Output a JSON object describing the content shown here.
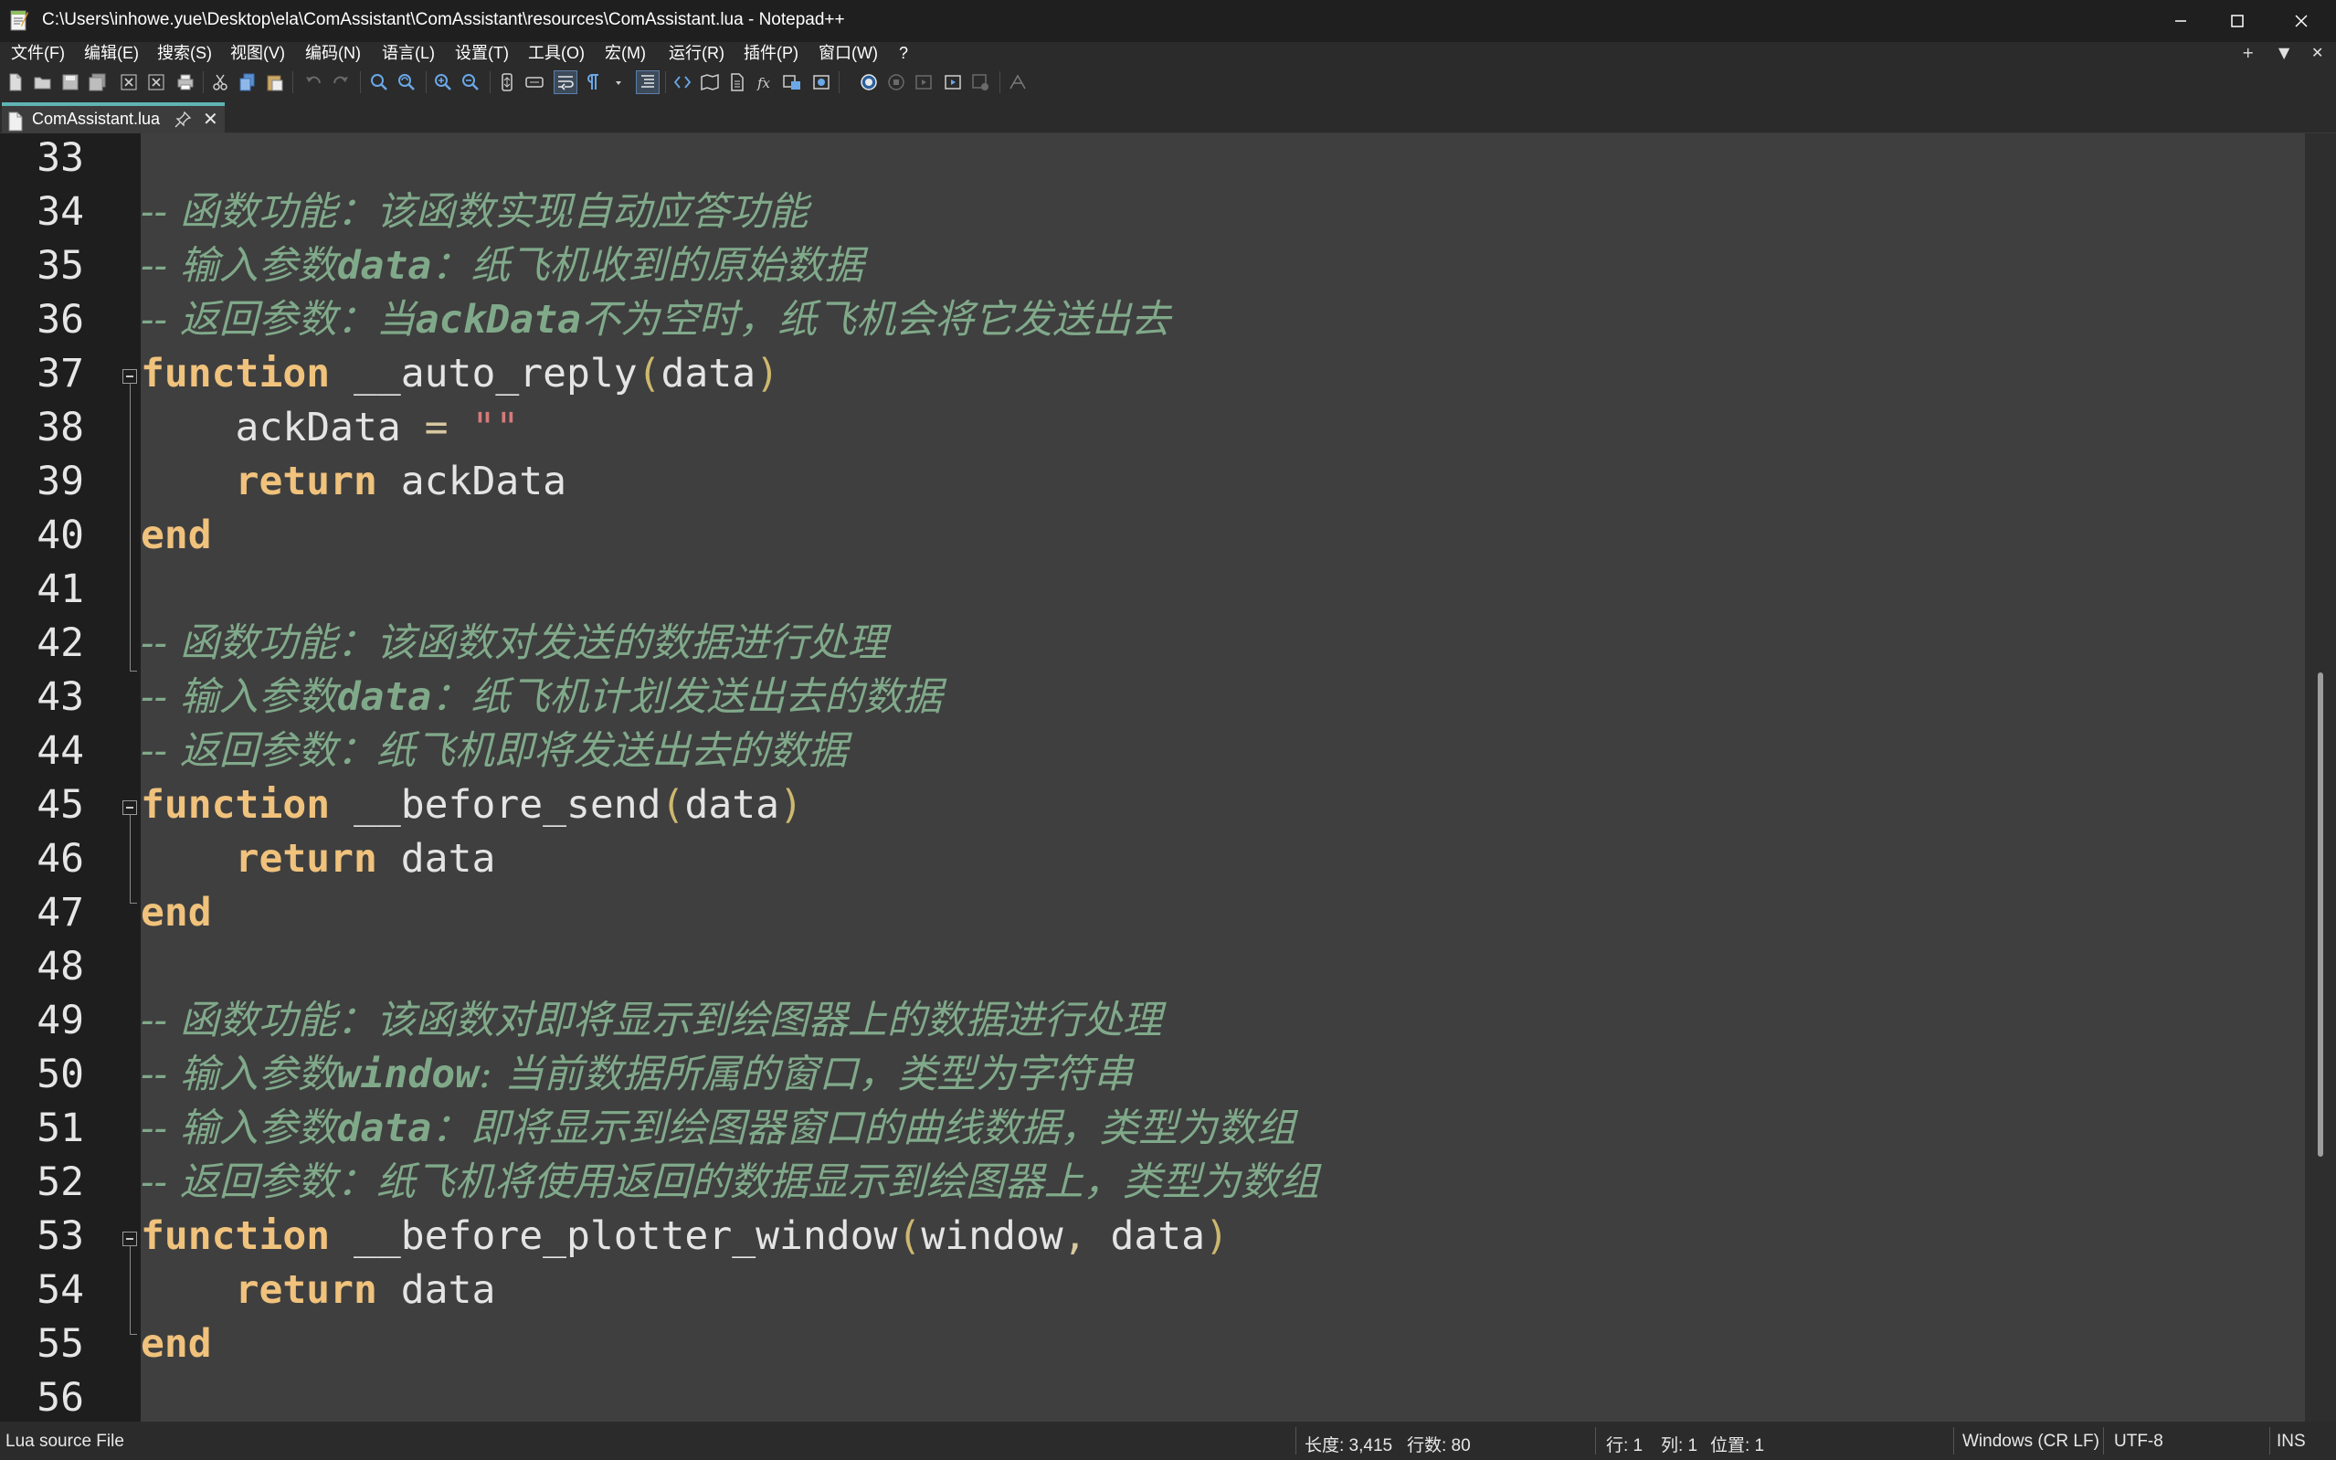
{
  "window": {
    "title": "C:\\Users\\inhowe.yue\\Desktop\\ela\\ComAssistant\\ComAssistant\\resources\\ComAssistant.lua - Notepad++"
  },
  "menu": {
    "items": [
      "文件(F)",
      "编辑(E)",
      "搜索(S)",
      "视图(V)",
      "编码(N)",
      "语言(L)",
      "设置(T)",
      "工具(O)",
      "宏(M)",
      "运行(R)",
      "插件(P)",
      "窗口(W)",
      "?"
    ],
    "right": [
      "+",
      "▼",
      "✕"
    ]
  },
  "toolbar": {
    "icons": [
      "new-file-icon",
      "open-file-icon",
      "save-icon",
      "save-all-icon",
      "close-icon",
      "close-all-icon",
      "print-icon",
      "cut-icon",
      "copy-icon",
      "paste-icon",
      "undo-icon",
      "redo-icon",
      "find-icon",
      "replace-icon",
      "zoom-in-icon",
      "zoom-out-icon",
      "sync-vertical-icon",
      "sync-horizontal-icon",
      "word-wrap-icon",
      "show-all-chars-icon",
      "indent-guide-icon",
      "user-language-icon",
      "document-map-icon",
      "document-list-icon",
      "function-list-icon",
      "folder-workspace-icon",
      "monitoring-icon",
      "record-macro-icon",
      "stop-macro-icon",
      "play-macro-icon",
      "run-macro-multiple-icon",
      "save-macro-icon",
      "spell-check-icon"
    ]
  },
  "tab": {
    "label": "ComAssistant.lua"
  },
  "editor": {
    "lines": [
      {
        "no": "33",
        "code": []
      },
      {
        "no": "34",
        "code": [
          {
            "t": "cm",
            "v": "-- 函数功能：该函数实现自动应答功能"
          }
        ]
      },
      {
        "no": "35",
        "code": [
          {
            "t": "cm",
            "v": "-- 输入参数"
          },
          {
            "t": "cmb",
            "v": "data"
          },
          {
            "t": "cm",
            "v": "：纸飞机收到的原始数据"
          }
        ]
      },
      {
        "no": "36",
        "code": [
          {
            "t": "cm",
            "v": "-- 返回参数：当"
          },
          {
            "t": "cmb",
            "v": "ackData"
          },
          {
            "t": "cm",
            "v": "不为空时，纸飞机会将它发送出去"
          }
        ]
      },
      {
        "no": "37",
        "code": [
          {
            "t": "kw",
            "v": "function"
          },
          {
            "t": "ident",
            "v": " __auto_reply"
          },
          {
            "t": "paren",
            "v": "("
          },
          {
            "t": "ident",
            "v": "data"
          },
          {
            "t": "paren",
            "v": ")"
          }
        ]
      },
      {
        "no": "38",
        "code": [
          {
            "t": "ident",
            "v": "    ackData "
          },
          {
            "t": "op",
            "v": "="
          },
          {
            "t": "ident",
            "v": " "
          },
          {
            "t": "str",
            "v": "\"\""
          }
        ]
      },
      {
        "no": "39",
        "code": [
          {
            "t": "ident",
            "v": "    "
          },
          {
            "t": "kw",
            "v": "return"
          },
          {
            "t": "ident",
            "v": " ackData"
          }
        ]
      },
      {
        "no": "40",
        "code": [
          {
            "t": "kw",
            "v": "end"
          }
        ]
      },
      {
        "no": "41",
        "code": []
      },
      {
        "no": "42",
        "code": [
          {
            "t": "cm",
            "v": "-- 函数功能：该函数对发送的数据进行处理"
          }
        ]
      },
      {
        "no": "43",
        "code": [
          {
            "t": "cm",
            "v": "-- 输入参数"
          },
          {
            "t": "cmb",
            "v": "data"
          },
          {
            "t": "cm",
            "v": "：纸飞机计划发送出去的数据"
          }
        ]
      },
      {
        "no": "44",
        "code": [
          {
            "t": "cm",
            "v": "-- 返回参数：纸飞机即将发送出去的数据"
          }
        ]
      },
      {
        "no": "45",
        "code": [
          {
            "t": "kw",
            "v": "function"
          },
          {
            "t": "ident",
            "v": " __before_send"
          },
          {
            "t": "paren",
            "v": "("
          },
          {
            "t": "ident",
            "v": "data"
          },
          {
            "t": "paren",
            "v": ")"
          }
        ]
      },
      {
        "no": "46",
        "code": [
          {
            "t": "ident",
            "v": "    "
          },
          {
            "t": "kw",
            "v": "return"
          },
          {
            "t": "ident",
            "v": " data"
          }
        ]
      },
      {
        "no": "47",
        "code": [
          {
            "t": "kw",
            "v": "end"
          }
        ]
      },
      {
        "no": "48",
        "code": []
      },
      {
        "no": "49",
        "code": [
          {
            "t": "cm",
            "v": "-- 函数功能：该函数对即将显示到绘图器上的数据进行处理"
          }
        ]
      },
      {
        "no": "50",
        "code": [
          {
            "t": "cm",
            "v": "-- 输入参数"
          },
          {
            "t": "cmb",
            "v": "window"
          },
          {
            "t": "cm",
            "v": ": 当前数据所属的窗口，类型为字符串"
          }
        ]
      },
      {
        "no": "51",
        "code": [
          {
            "t": "cm",
            "v": "-- 输入参数"
          },
          {
            "t": "cmb",
            "v": "data"
          },
          {
            "t": "cm",
            "v": "：即将显示到绘图器窗口的曲线数据，类型为数组"
          }
        ]
      },
      {
        "no": "52",
        "code": [
          {
            "t": "cm",
            "v": "-- 返回参数：纸飞机将使用返回的数据显示到绘图器上，类型为数组"
          }
        ]
      },
      {
        "no": "53",
        "code": [
          {
            "t": "kw",
            "v": "function"
          },
          {
            "t": "ident",
            "v": " __before_plotter_window"
          },
          {
            "t": "paren",
            "v": "("
          },
          {
            "t": "ident",
            "v": "window"
          },
          {
            "t": "op",
            "v": ","
          },
          {
            "t": "ident",
            "v": " data"
          },
          {
            "t": "paren",
            "v": ")"
          }
        ]
      },
      {
        "no": "54",
        "code": [
          {
            "t": "ident",
            "v": "    "
          },
          {
            "t": "kw",
            "v": "return"
          },
          {
            "t": "ident",
            "v": " data"
          }
        ]
      },
      {
        "no": "55",
        "code": [
          {
            "t": "kw",
            "v": "end"
          }
        ]
      },
      {
        "no": "56",
        "code": []
      }
    ]
  },
  "status": {
    "file_type": "Lua source File",
    "length": "长度: 3,415",
    "lines": "行数: 80",
    "line": "行: 1",
    "col": "列: 1",
    "pos": "位置: 1",
    "eol": "Windows (CR LF)",
    "encoding": "UTF-8",
    "mode": "INS"
  },
  "colors": {
    "editor_bg": "#3f3f3f",
    "gutter_bg": "#1e1e1e",
    "keyword": "#f0c27c",
    "comment": "#80a98a",
    "string": "#d77a7a",
    "tab_accent": "#5fb4b4"
  }
}
